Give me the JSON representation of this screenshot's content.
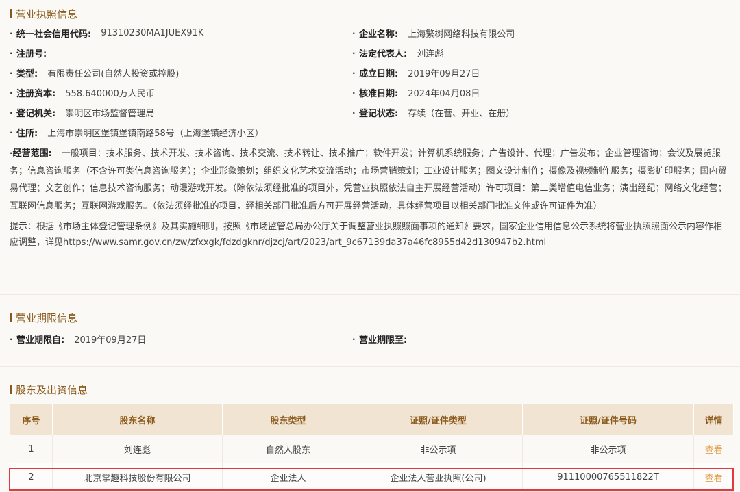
{
  "license": {
    "title": "营业执照信息",
    "fields": {
      "credit_code_label": "统一社会信用代码:",
      "credit_code": "91310230MA1JUEX91K",
      "company_name_label": "企业名称:",
      "company_name": "上海繁树网络科技有限公司",
      "reg_no_label": "注册号:",
      "reg_no": "",
      "legal_rep_label": "法定代表人:",
      "legal_rep": "刘连彪",
      "type_label": "类型:",
      "type": "有限责任公司(自然人投资或控股)",
      "founded_label": "成立日期:",
      "founded": "2019年09月27日",
      "capital_label": "注册资本:",
      "capital": "558.640000万人民币",
      "approved_label": "核准日期:",
      "approved": "2024年04月08日",
      "authority_label": "登记机关:",
      "authority": "崇明区市场监督管理局",
      "status_label": "登记状态:",
      "status": "存续（在营、开业、在册）",
      "address_label": "住所:",
      "address": "上海市崇明区堡镇堡镇南路58号（上海堡镇经济小区）",
      "scope_label": "经营范围:",
      "scope": "一般项目：技术服务、技术开发、技术咨询、技术交流、技术转让、技术推广；软件开发；计算机系统服务；广告设计、代理；广告发布；企业管理咨询；会议及展览服务；信息咨询服务（不含许可类信息咨询服务）；企业形象策划；组织文化艺术交流活动；市场营销策划；工业设计服务；图文设计制作；摄像及视频制作服务；摄影扩印服务；国内贸易代理；文艺创作；信息技术咨询服务；动漫游戏开发。（除依法须经批准的项目外，凭营业执照依法自主开展经营活动）许可项目：第二类增值电信业务；演出经纪；网络文化经营；互联网信息服务；互联网游戏服务。（依法须经批准的项目，经相关部门批准后方可开展经营活动，具体经营项目以相关部门批准文件或许可证件为准）"
    },
    "notice": "提示：根据《市场主体登记管理条例》及其实施细则，按照《市场监管总局办公厅关于调整营业执照照面事项的通知》要求，国家企业信用信息公示系统将营业执照照面公示内容作相应调整，详见https://www.samr.gov.cn/zw/zfxxgk/fdzdgknr/djzcj/art/2023/art_9c67139da37a46fc8955d42d130947b2.html"
  },
  "term": {
    "title": "营业期限信息",
    "from_label": "营业期限自:",
    "from": "2019年09月27日",
    "to_label": "营业期限至:",
    "to": ""
  },
  "shareholders": {
    "title": "股东及出资信息",
    "headers": [
      "序号",
      "股东名称",
      "股东类型",
      "证照/证件类型",
      "证照/证件号码",
      "详情"
    ],
    "rows": [
      [
        "1",
        "刘连彪",
        "自然人股东",
        "非公示项",
        "非公示项",
        "查看"
      ],
      [
        "2",
        "北京掌趣科技股份有限公司",
        "企业法人",
        "企业法人营业执照(公司)",
        "91110000765511822T",
        "查看"
      ]
    ],
    "colors": {
      "header_bg": "#f2e4d2",
      "header_text": "#8a5a1c",
      "link": "#e0a04a",
      "highlight": "#e0393e"
    }
  }
}
